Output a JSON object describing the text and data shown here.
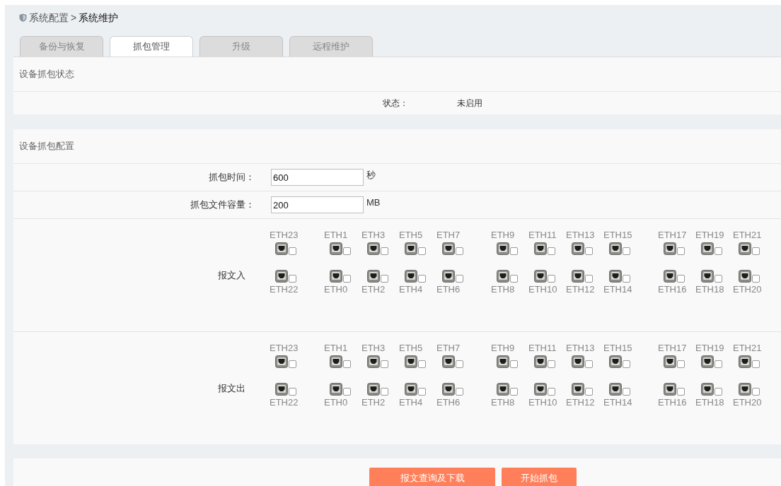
{
  "breadcrumb": {
    "parent": "系统配置",
    "separator": ">",
    "current": "系统维护"
  },
  "tabs": [
    {
      "label": "备份与恢复",
      "selected": false
    },
    {
      "label": "抓包管理",
      "selected": true
    },
    {
      "label": "升级",
      "selected": false
    },
    {
      "label": "远程维护",
      "selected": false
    }
  ],
  "status_section": {
    "title": "设备抓包状态",
    "label": "状态：",
    "value": "未启用"
  },
  "config_section": {
    "title": "设备抓包配置",
    "fields": [
      {
        "label": "抓包时间：",
        "value": "600",
        "unit": "秒"
      },
      {
        "label": "抓包文件容量：",
        "value": "200",
        "unit": "MB"
      }
    ],
    "port_sets": [
      {
        "label": "报文入",
        "groups": [
          [
            {
              "top": {
                "label": "ETH23",
                "checked": false
              },
              "bottom": {
                "label": "ETH22",
                "checked": false
              }
            }
          ],
          [
            {
              "top": {
                "label": "ETH1",
                "checked": false
              },
              "bottom": {
                "label": "ETH0",
                "checked": false
              }
            },
            {
              "top": {
                "label": "ETH3",
                "checked": false
              },
              "bottom": {
                "label": "ETH2",
                "checked": false
              }
            },
            {
              "top": {
                "label": "ETH5",
                "checked": false
              },
              "bottom": {
                "label": "ETH4",
                "checked": false
              }
            },
            {
              "top": {
                "label": "ETH7",
                "checked": false
              },
              "bottom": {
                "label": "ETH6",
                "checked": false
              }
            }
          ],
          [
            {
              "top": {
                "label": "ETH9",
                "checked": false
              },
              "bottom": {
                "label": "ETH8",
                "checked": false
              }
            },
            {
              "top": {
                "label": "ETH11",
                "checked": false
              },
              "bottom": {
                "label": "ETH10",
                "checked": false
              }
            },
            {
              "top": {
                "label": "ETH13",
                "checked": false
              },
              "bottom": {
                "label": "ETH12",
                "checked": false
              }
            },
            {
              "top": {
                "label": "ETH15",
                "checked": false
              },
              "bottom": {
                "label": "ETH14",
                "checked": false
              }
            }
          ],
          [
            {
              "top": {
                "label": "ETH17",
                "checked": false
              },
              "bottom": {
                "label": "ETH16",
                "checked": false
              }
            },
            {
              "top": {
                "label": "ETH19",
                "checked": false
              },
              "bottom": {
                "label": "ETH18",
                "checked": false
              }
            },
            {
              "top": {
                "label": "ETH21",
                "checked": false
              },
              "bottom": {
                "label": "ETH20",
                "checked": false
              }
            }
          ]
        ]
      },
      {
        "label": "报文出",
        "groups": [
          [
            {
              "top": {
                "label": "ETH23",
                "checked": false
              },
              "bottom": {
                "label": "ETH22",
                "checked": false
              }
            }
          ],
          [
            {
              "top": {
                "label": "ETH1",
                "checked": false
              },
              "bottom": {
                "label": "ETH0",
                "checked": false
              }
            },
            {
              "top": {
                "label": "ETH3",
                "checked": false
              },
              "bottom": {
                "label": "ETH2",
                "checked": false
              }
            },
            {
              "top": {
                "label": "ETH5",
                "checked": false
              },
              "bottom": {
                "label": "ETH4",
                "checked": false
              }
            },
            {
              "top": {
                "label": "ETH7",
                "checked": false
              },
              "bottom": {
                "label": "ETH6",
                "checked": false
              }
            }
          ],
          [
            {
              "top": {
                "label": "ETH9",
                "checked": false
              },
              "bottom": {
                "label": "ETH8",
                "checked": false
              }
            },
            {
              "top": {
                "label": "ETH11",
                "checked": false
              },
              "bottom": {
                "label": "ETH10",
                "checked": false
              }
            },
            {
              "top": {
                "label": "ETH13",
                "checked": false
              },
              "bottom": {
                "label": "ETH12",
                "checked": false
              }
            },
            {
              "top": {
                "label": "ETH15",
                "checked": false
              },
              "bottom": {
                "label": "ETH14",
                "checked": false
              }
            }
          ],
          [
            {
              "top": {
                "label": "ETH17",
                "checked": false
              },
              "bottom": {
                "label": "ETH16",
                "checked": false
              }
            },
            {
              "top": {
                "label": "ETH19",
                "checked": false
              },
              "bottom": {
                "label": "ETH18",
                "checked": false
              }
            },
            {
              "top": {
                "label": "ETH21",
                "checked": false
              },
              "bottom": {
                "label": "ETH20",
                "checked": false
              }
            }
          ]
        ]
      }
    ]
  },
  "buttons": [
    "报文查询及下载",
    "开始抓包"
  ]
}
